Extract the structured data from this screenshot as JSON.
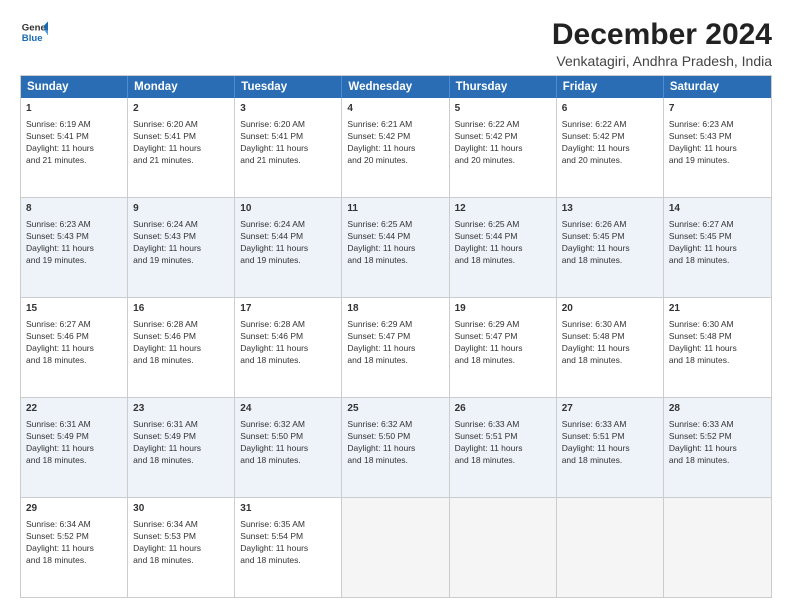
{
  "logo": {
    "line1": "General",
    "line2": "Blue"
  },
  "title": "December 2024",
  "subtitle": "Venkatagiri, Andhra Pradesh, India",
  "header_days": [
    "Sunday",
    "Monday",
    "Tuesday",
    "Wednesday",
    "Thursday",
    "Friday",
    "Saturday"
  ],
  "weeks": [
    [
      {
        "day": "1",
        "lines": [
          "Sunrise: 6:19 AM",
          "Sunset: 5:41 PM",
          "Daylight: 11 hours",
          "and 21 minutes."
        ]
      },
      {
        "day": "2",
        "lines": [
          "Sunrise: 6:20 AM",
          "Sunset: 5:41 PM",
          "Daylight: 11 hours",
          "and 21 minutes."
        ]
      },
      {
        "day": "3",
        "lines": [
          "Sunrise: 6:20 AM",
          "Sunset: 5:41 PM",
          "Daylight: 11 hours",
          "and 21 minutes."
        ]
      },
      {
        "day": "4",
        "lines": [
          "Sunrise: 6:21 AM",
          "Sunset: 5:42 PM",
          "Daylight: 11 hours",
          "and 20 minutes."
        ]
      },
      {
        "day": "5",
        "lines": [
          "Sunrise: 6:22 AM",
          "Sunset: 5:42 PM",
          "Daylight: 11 hours",
          "and 20 minutes."
        ]
      },
      {
        "day": "6",
        "lines": [
          "Sunrise: 6:22 AM",
          "Sunset: 5:42 PM",
          "Daylight: 11 hours",
          "and 20 minutes."
        ]
      },
      {
        "day": "7",
        "lines": [
          "Sunrise: 6:23 AM",
          "Sunset: 5:43 PM",
          "Daylight: 11 hours",
          "and 19 minutes."
        ]
      }
    ],
    [
      {
        "day": "8",
        "lines": [
          "Sunrise: 6:23 AM",
          "Sunset: 5:43 PM",
          "Daylight: 11 hours",
          "and 19 minutes."
        ]
      },
      {
        "day": "9",
        "lines": [
          "Sunrise: 6:24 AM",
          "Sunset: 5:43 PM",
          "Daylight: 11 hours",
          "and 19 minutes."
        ]
      },
      {
        "day": "10",
        "lines": [
          "Sunrise: 6:24 AM",
          "Sunset: 5:44 PM",
          "Daylight: 11 hours",
          "and 19 minutes."
        ]
      },
      {
        "day": "11",
        "lines": [
          "Sunrise: 6:25 AM",
          "Sunset: 5:44 PM",
          "Daylight: 11 hours",
          "and 18 minutes."
        ]
      },
      {
        "day": "12",
        "lines": [
          "Sunrise: 6:25 AM",
          "Sunset: 5:44 PM",
          "Daylight: 11 hours",
          "and 18 minutes."
        ]
      },
      {
        "day": "13",
        "lines": [
          "Sunrise: 6:26 AM",
          "Sunset: 5:45 PM",
          "Daylight: 11 hours",
          "and 18 minutes."
        ]
      },
      {
        "day": "14",
        "lines": [
          "Sunrise: 6:27 AM",
          "Sunset: 5:45 PM",
          "Daylight: 11 hours",
          "and 18 minutes."
        ]
      }
    ],
    [
      {
        "day": "15",
        "lines": [
          "Sunrise: 6:27 AM",
          "Sunset: 5:46 PM",
          "Daylight: 11 hours",
          "and 18 minutes."
        ]
      },
      {
        "day": "16",
        "lines": [
          "Sunrise: 6:28 AM",
          "Sunset: 5:46 PM",
          "Daylight: 11 hours",
          "and 18 minutes."
        ]
      },
      {
        "day": "17",
        "lines": [
          "Sunrise: 6:28 AM",
          "Sunset: 5:46 PM",
          "Daylight: 11 hours",
          "and 18 minutes."
        ]
      },
      {
        "day": "18",
        "lines": [
          "Sunrise: 6:29 AM",
          "Sunset: 5:47 PM",
          "Daylight: 11 hours",
          "and 18 minutes."
        ]
      },
      {
        "day": "19",
        "lines": [
          "Sunrise: 6:29 AM",
          "Sunset: 5:47 PM",
          "Daylight: 11 hours",
          "and 18 minutes."
        ]
      },
      {
        "day": "20",
        "lines": [
          "Sunrise: 6:30 AM",
          "Sunset: 5:48 PM",
          "Daylight: 11 hours",
          "and 18 minutes."
        ]
      },
      {
        "day": "21",
        "lines": [
          "Sunrise: 6:30 AM",
          "Sunset: 5:48 PM",
          "Daylight: 11 hours",
          "and 18 minutes."
        ]
      }
    ],
    [
      {
        "day": "22",
        "lines": [
          "Sunrise: 6:31 AM",
          "Sunset: 5:49 PM",
          "Daylight: 11 hours",
          "and 18 minutes."
        ]
      },
      {
        "day": "23",
        "lines": [
          "Sunrise: 6:31 AM",
          "Sunset: 5:49 PM",
          "Daylight: 11 hours",
          "and 18 minutes."
        ]
      },
      {
        "day": "24",
        "lines": [
          "Sunrise: 6:32 AM",
          "Sunset: 5:50 PM",
          "Daylight: 11 hours",
          "and 18 minutes."
        ]
      },
      {
        "day": "25",
        "lines": [
          "Sunrise: 6:32 AM",
          "Sunset: 5:50 PM",
          "Daylight: 11 hours",
          "and 18 minutes."
        ]
      },
      {
        "day": "26",
        "lines": [
          "Sunrise: 6:33 AM",
          "Sunset: 5:51 PM",
          "Daylight: 11 hours",
          "and 18 minutes."
        ]
      },
      {
        "day": "27",
        "lines": [
          "Sunrise: 6:33 AM",
          "Sunset: 5:51 PM",
          "Daylight: 11 hours",
          "and 18 minutes."
        ]
      },
      {
        "day": "28",
        "lines": [
          "Sunrise: 6:33 AM",
          "Sunset: 5:52 PM",
          "Daylight: 11 hours",
          "and 18 minutes."
        ]
      }
    ],
    [
      {
        "day": "29",
        "lines": [
          "Sunrise: 6:34 AM",
          "Sunset: 5:52 PM",
          "Daylight: 11 hours",
          "and 18 minutes."
        ]
      },
      {
        "day": "30",
        "lines": [
          "Sunrise: 6:34 AM",
          "Sunset: 5:53 PM",
          "Daylight: 11 hours",
          "and 18 minutes."
        ]
      },
      {
        "day": "31",
        "lines": [
          "Sunrise: 6:35 AM",
          "Sunset: 5:54 PM",
          "Daylight: 11 hours",
          "and 18 minutes."
        ]
      },
      {
        "day": "",
        "lines": []
      },
      {
        "day": "",
        "lines": []
      },
      {
        "day": "",
        "lines": []
      },
      {
        "day": "",
        "lines": []
      }
    ]
  ]
}
